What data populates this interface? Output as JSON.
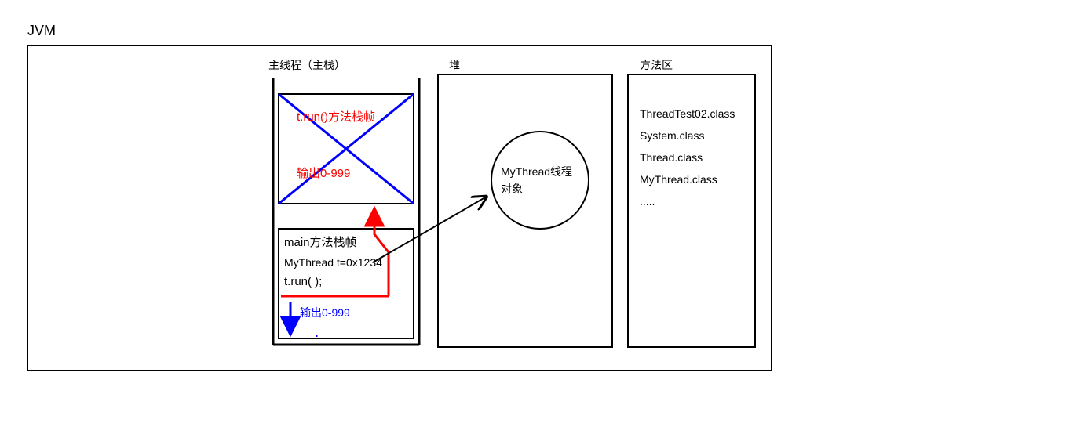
{
  "title": "JVM",
  "stack": {
    "label": "主线程（主栈）",
    "top_frame": {
      "title": "t.run()方法栈帧",
      "output": "输出0-999"
    },
    "main_frame": {
      "title": "main方法栈帧",
      "line1": "MyThread t=0x1234",
      "line2": "t.run( );",
      "output": "输出0-999"
    }
  },
  "heap": {
    "label": "堆",
    "object_l1": "MyThread线程",
    "object_l2": "对象"
  },
  "method_area": {
    "label": "方法区",
    "items": [
      "ThreadTest02.class",
      "System.class",
      "Thread.class",
      "MyThread.class",
      "....."
    ]
  }
}
